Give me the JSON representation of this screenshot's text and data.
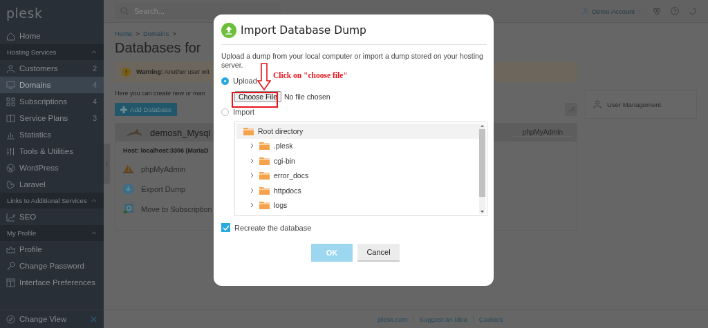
{
  "sidebar": {
    "logo": "plesk",
    "items": [
      {
        "kind": "item",
        "label": "Home",
        "selected": false
      },
      {
        "kind": "section",
        "label": "Hosting Services",
        "expanded": true
      },
      {
        "kind": "item",
        "label": "Customers",
        "count": "2",
        "selected": false
      },
      {
        "kind": "item",
        "label": "Domains",
        "count": "4",
        "selected": true
      },
      {
        "kind": "item",
        "label": "Subscriptions",
        "count": "4",
        "selected": false
      },
      {
        "kind": "item",
        "label": "Service Plans",
        "count": "3",
        "selected": false
      },
      {
        "kind": "item",
        "label": "Statistics",
        "selected": false
      },
      {
        "kind": "item",
        "label": "Tools & Utilities",
        "selected": false
      },
      {
        "kind": "item",
        "label": "WordPress",
        "selected": false
      },
      {
        "kind": "item",
        "label": "Laravel",
        "selected": false
      },
      {
        "kind": "section",
        "label": "Links to Additional Services",
        "expanded": true
      },
      {
        "kind": "item",
        "label": "SEO",
        "selected": false
      },
      {
        "kind": "section",
        "label": "My Profile",
        "expanded": true
      },
      {
        "kind": "item",
        "label": "Profile",
        "selected": false
      },
      {
        "kind": "item",
        "label": "Change Password",
        "selected": false
      },
      {
        "kind": "item",
        "label": "Interface Preferences",
        "selected": false
      }
    ],
    "footer": {
      "label": "Change View"
    }
  },
  "topbar": {
    "search": {
      "placeholder": "Search..."
    },
    "account": "Demo Account"
  },
  "breadcrumb": {
    "items": [
      "Home",
      "Domains"
    ],
    "separator": ">"
  },
  "page_title": "Databases for",
  "warning": {
    "label": "Warning:",
    "text": "Another user wit"
  },
  "intro": "Here you can create new or man",
  "add_button": "Add Database",
  "database": {
    "name": "demosh_Mysql",
    "host": "Host: localhost:3306 (MariaD",
    "tab": "phpMyAdmin",
    "actions": [
      "phpMyAdmin",
      "Export Dump",
      "Move to Subscription"
    ]
  },
  "side_panel": {
    "label": "User Management"
  },
  "footer_links": [
    "plesk.com",
    "Suggest an Idea",
    "Cookies"
  ],
  "dialog": {
    "title": "Import Database Dump",
    "description": "Upload a dump from your local computer or import a dump stored on your hosting server.",
    "options": [
      {
        "kind": "upload",
        "label": "Upload",
        "selected": true
      },
      {
        "kind": "import",
        "label": "Import",
        "selected": false
      }
    ],
    "file_input": {
      "button": "Choose File",
      "status": "No file chosen"
    },
    "tree": {
      "label": "Root directory",
      "selected": true,
      "expanded": true,
      "children": [
        {
          "label": ".plesk",
          "expanded": false
        },
        {
          "label": "cgi-bin",
          "expanded": false
        },
        {
          "label": "error_docs",
          "expanded": false
        },
        {
          "label": "httpdocs",
          "expanded": false
        },
        {
          "label": "logs",
          "expanded": false
        }
      ]
    },
    "recreate": {
      "label": "Recreate the database",
      "checked": true
    },
    "buttons": [
      {
        "label": "OK",
        "disabled": true
      },
      {
        "label": "Cancel",
        "disabled": false
      }
    ],
    "annotation": {
      "text": "Click on \"choose file\""
    }
  }
}
